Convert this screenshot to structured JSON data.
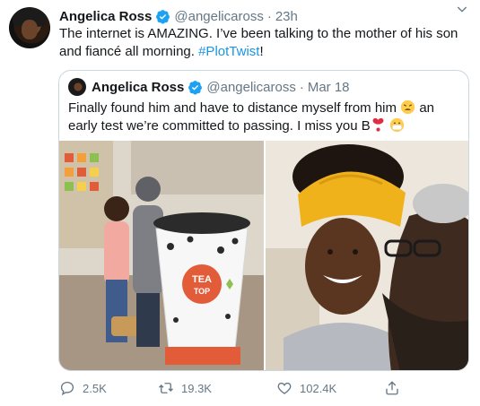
{
  "tweet": {
    "author_name": "Angelica Ross",
    "author_handle": "@angelicaross",
    "separator": "·",
    "time": "23h",
    "text_main": "The internet is AMAZING.  I’ve been talking to the mother of his son and fiancé all morning. ",
    "hashtag": "#PlotTwist",
    "text_end": "!"
  },
  "quote": {
    "author_name": "Angelica Ross",
    "author_handle": "@angelicaross",
    "separator": "·",
    "date": "Mar 18",
    "text_part1": "Finally found him and have to distance myself from him ",
    "text_part2": " an early test we’re committed to passing.  I miss you B",
    "photo_text": {
      "cup_brand": "TEA",
      "cup_brand_sub": "TOP"
    }
  },
  "actions": {
    "replies": "2.5K",
    "retweets": "19.3K",
    "likes": "102.4K"
  },
  "colors": {
    "accent": "#1b95e0",
    "secondary_text": "#657786",
    "border": "#ccd6dd"
  },
  "icons": [
    "verified-badge-icon",
    "caret-down-icon",
    "reply-icon",
    "retweet-icon",
    "like-icon",
    "share-icon",
    "tired-face-emoji",
    "heart-exclamation-emoji",
    "mask-face-emoji"
  ]
}
